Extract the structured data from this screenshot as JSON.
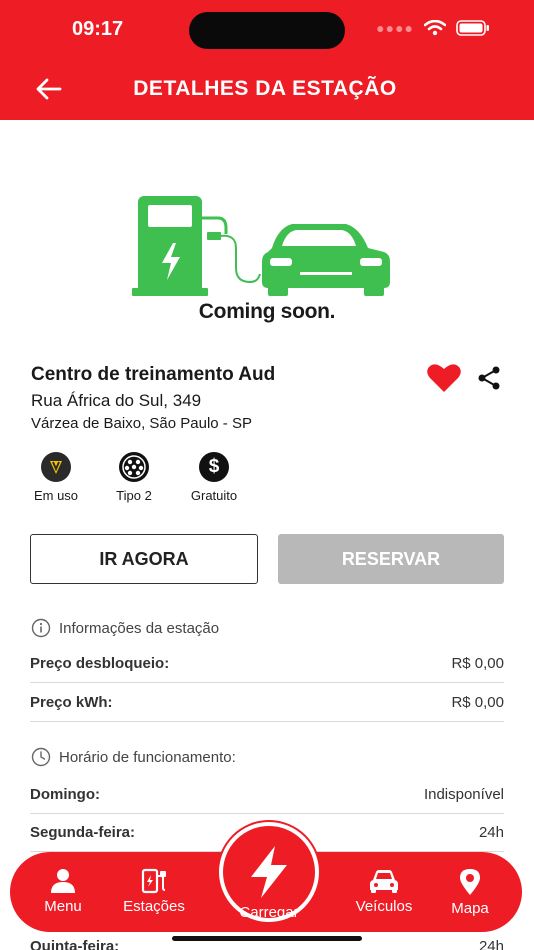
{
  "status": {
    "time": "09:17"
  },
  "header": {
    "title": "DETALHES DA ESTAÇÃO"
  },
  "hero": {
    "caption": "Coming soon.",
    "accent": "#3fbf4f"
  },
  "station": {
    "name": "Centro de treinamento Aud",
    "street": "Rua África do Sul, 349",
    "city": "Várzea de Baixo, São Paulo - SP"
  },
  "features": [
    {
      "label": "Em uso",
      "icon": "plug-status-icon"
    },
    {
      "label": "Tipo 2",
      "icon": "type2-connector-icon"
    },
    {
      "label": "Gratuito",
      "icon": "dollar-icon"
    }
  ],
  "actions": {
    "go_label": "IR AGORA",
    "reserve_label": "RESERVAR"
  },
  "info": {
    "heading": "Informações da estação",
    "rows": [
      {
        "key": "Preço desbloqueio:",
        "value": "R$ 0,00"
      },
      {
        "key": "Preço kWh:",
        "value": "R$ 0,00"
      }
    ]
  },
  "hours": {
    "heading": "Horário de funcionamento:",
    "rows": [
      {
        "key": "Domingo:",
        "value": "Indisponível"
      },
      {
        "key": "Segunda-feira:",
        "value": "24h"
      },
      {
        "key": "Quinta-feira:",
        "value": "24h"
      }
    ]
  },
  "nav": {
    "items": [
      {
        "label": "Menu",
        "icon": "person-icon"
      },
      {
        "label": "Estações",
        "icon": "charging-station-icon"
      },
      {
        "label": "Carregar",
        "icon": "lightning-icon"
      },
      {
        "label": "Veículos",
        "icon": "car-icon"
      },
      {
        "label": "Mapa",
        "icon": "map-pin-icon"
      }
    ]
  },
  "colors": {
    "brand": "#ee1c25",
    "disabled": "#b8b8b8"
  }
}
